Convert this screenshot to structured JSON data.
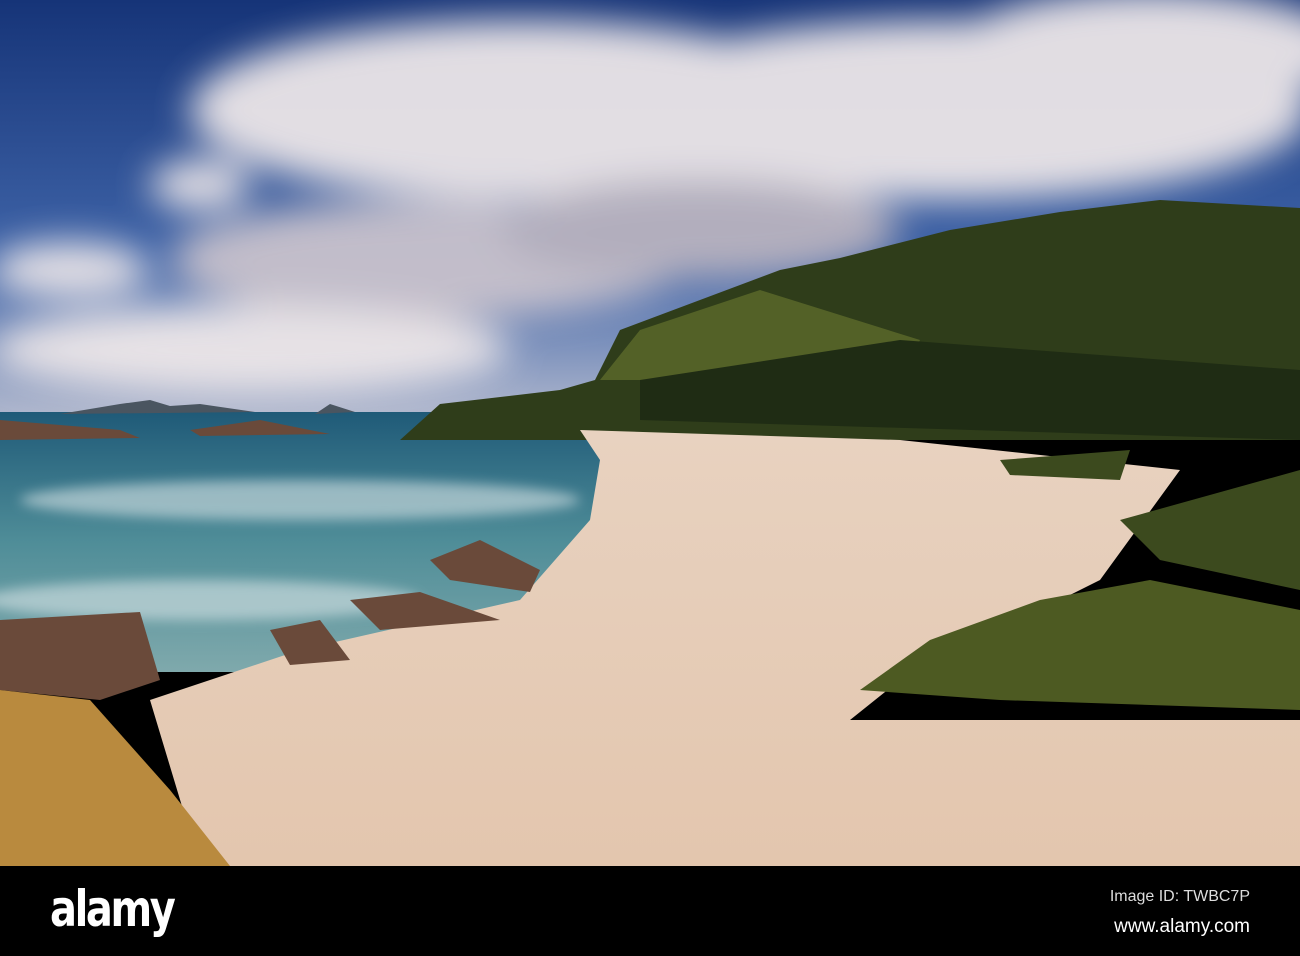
{
  "watermark": {
    "logo": "alamy",
    "image_id": "Image ID: TWBC7P",
    "website": "www.alamy.com"
  },
  "colors": {
    "sky": "#1d3f86",
    "cloud": "#e9e4e6",
    "hill": "#2c3a18",
    "sea": "#2d7282",
    "sand": "#eedbcc",
    "bar": "#000000"
  }
}
